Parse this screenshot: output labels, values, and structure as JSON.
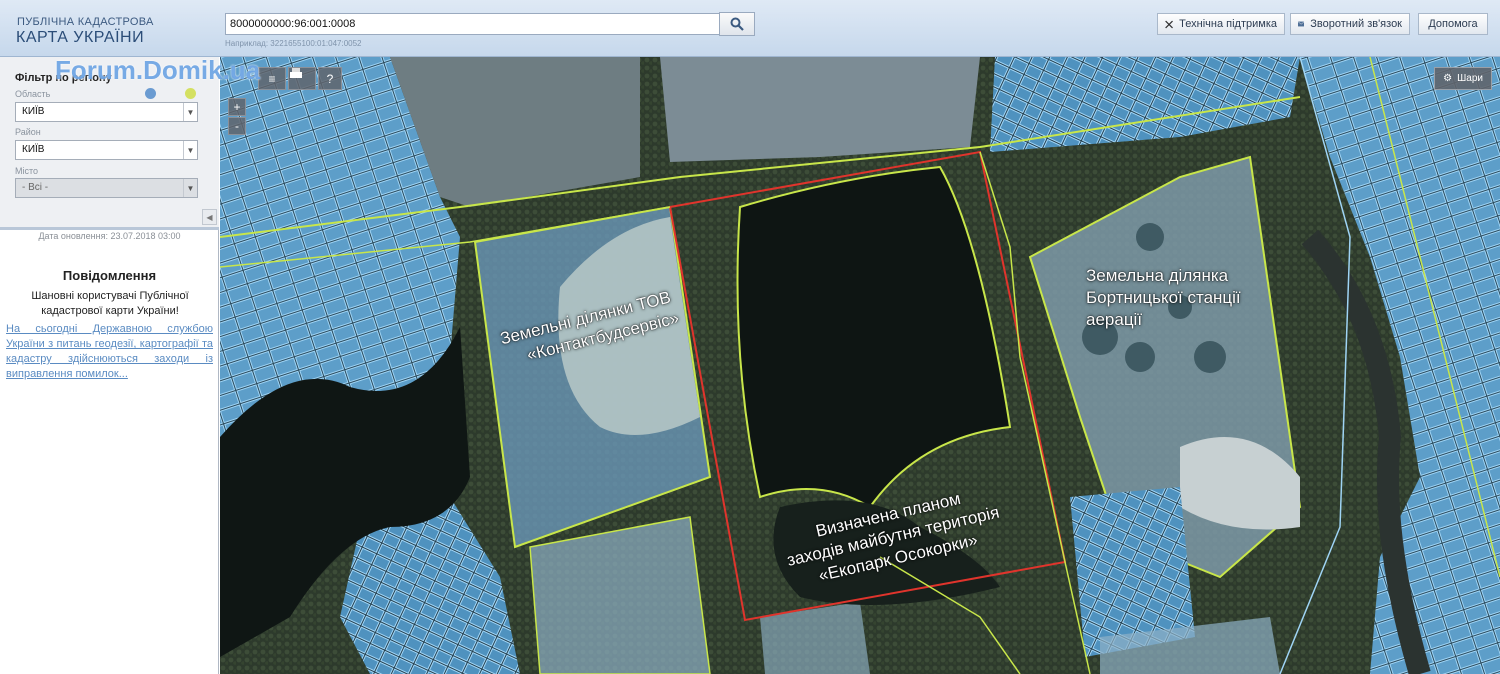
{
  "header": {
    "logo_top": "ПУБЛІЧНА КАДАСТРОВА",
    "logo_main": "КАРТА УКРАЇНИ",
    "search_value": "8000000000:96:001:0008",
    "search_hint": "Наприклад: 3221655100:01:047:0052",
    "buttons": {
      "support": "Технічна підтримка",
      "feedback": "Зворотний зв'язок",
      "help": "Допомога"
    }
  },
  "sidebar": {
    "filter_title": "Фільтр по регіону",
    "region_label": "Область",
    "region_value": "КИЇВ",
    "district_label": "Район",
    "district_value": "КИЇВ",
    "city_label": "Місто",
    "city_value": "- Всі -",
    "update_date": "Дата оновлення: 23.07.2018 03:00",
    "news_title": "Повідомлення",
    "news_text": "Шановні користувачі Публічної кадастрової карти України!",
    "news_link": "На сьогодні Державною службою України з питань геодезії, картографії та кадастру здійснюються заходи із виправлення помилок..."
  },
  "map": {
    "layers_label": "Шари",
    "zoom_in": "+",
    "zoom_out": "-",
    "labels": {
      "kontakt_line1": "Земельні ділянки ТОВ",
      "kontakt_line2": "«Контактбудсервіс»",
      "station_line1": "Земельна ділянка",
      "station_line2": "Бортницької станції",
      "station_line3": "аерації",
      "ecopark_line1": "Визначена планом",
      "ecopark_line2": "заходів майбутня територія",
      "ecopark_line3": "«Екопарк Осокорки»"
    }
  },
  "watermark": "Forum.Domik.ua",
  "colors": {
    "parcel_outline": "#c8e64a",
    "parcel_fill": "#8fc9ee",
    "ecopark_outline": "#e0342c",
    "accent": "#2b4d78"
  }
}
